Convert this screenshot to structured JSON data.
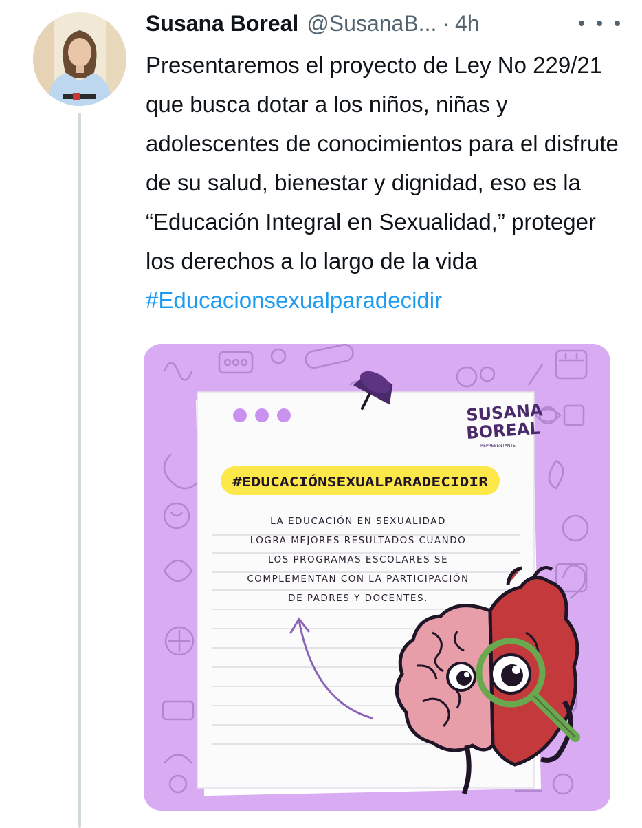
{
  "tweet": {
    "author_name": "Susana Boreal",
    "author_handle": "@SusanaB...",
    "separator": "·",
    "timestamp": "4h",
    "more_icon": "more-horizontal-icon",
    "text_before": "Presentaremos el proyecto de Ley No 229/21 que busca dotar a los niños, niñas y adolescentes de conocimientos para el disfrute de su salud, bienestar y dignidad, eso es la “Educación Integral en Sexualidad,” proteger los derechos a lo largo de la vida ",
    "hashtag": "#Educacionsexualparadecidir"
  },
  "media": {
    "logo_line1": "SUSANA",
    "logo_line2": "BOREAL",
    "logo_sub": "REPRESENTANTE",
    "hashtag_banner": "#EDUCACIÓNSEXUALPARADECIDIR",
    "body_lines": [
      "LA EDUCACIÓN EN SEXUALIDAD",
      "LOGRA MEJORES RESULTADOS CUANDO",
      "LOS PROGRAMAS ESCOLARES SE",
      "COMPLEMENTAN CON LA PARTICIPACIÓN",
      "DE PADRES Y DOCENTES."
    ],
    "colors": {
      "background": "#d9abf2",
      "accent_purple": "#4a2a6b",
      "banner_yellow": "#fde84a",
      "dots": "#c892ee"
    }
  }
}
